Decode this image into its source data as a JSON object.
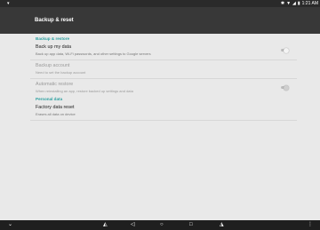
{
  "status_bar": {
    "time": "1:21 AM",
    "icons": [
      "notification-icon",
      "bluetooth-icon",
      "wifi-icon",
      "signal-icon",
      "battery-icon"
    ]
  },
  "app_bar": {
    "title": "Backup & reset"
  },
  "sections": [
    {
      "header": "Backup & restore",
      "items": [
        {
          "title": "Back up my data",
          "summary": "Back up app data, Wi-Fi passwords, and other settings to Google servers",
          "toggle": "off",
          "enabled": true
        },
        {
          "title": "Backup account",
          "summary": "Need to set the backup account",
          "enabled": false
        },
        {
          "title": "Automatic restore",
          "summary": "When reinstalling an app, restore backed up settings and data",
          "toggle": "off",
          "enabled": false
        }
      ]
    },
    {
      "header": "Personal data",
      "items": [
        {
          "title": "Factory data reset",
          "summary": "Erases all data on device",
          "enabled": true
        }
      ]
    }
  ],
  "nav_bar": {
    "icons": [
      "keyboard-hide-icon",
      "volume-down-icon",
      "back-icon",
      "home-icon",
      "recents-icon",
      "volume-up-icon",
      "menu-icon"
    ]
  },
  "colors": {
    "accent": "#2b9f9f",
    "app_bar": "#383838",
    "background": "#e9e9e9"
  }
}
